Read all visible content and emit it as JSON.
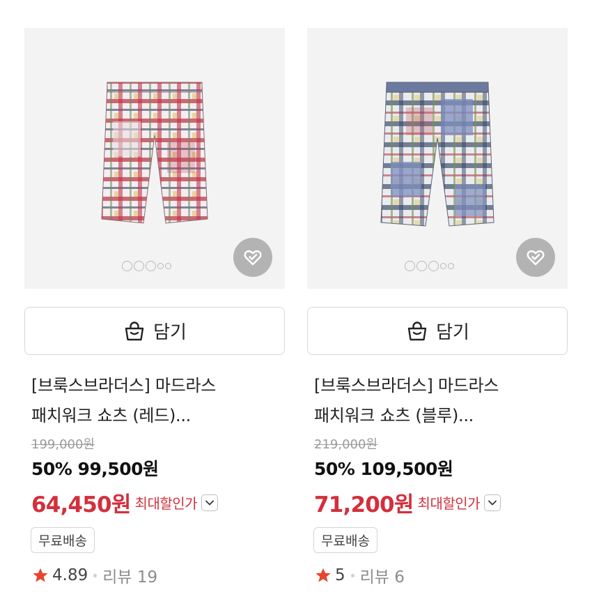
{
  "colors": {
    "accent_red": "#d32f3c",
    "card_bg": "#f3f3f3",
    "wish_bg": "#b3b3b3",
    "star": "#e8442e"
  },
  "products": [
    {
      "title_line1": "[브룩스브라더스] 마드라스",
      "title_line2": "패치워크 쇼츠 (레드)...",
      "original_price": "199,000원",
      "discount_price": "50% 99,500원",
      "max_discount_price": "64,450원",
      "max_discount_label": "최대할인가",
      "cart_label": "담기",
      "shipping_badge": "무료배송",
      "rating": "4.89",
      "reviews": "리뷰 19",
      "image_icon": "plaid-shorts-red",
      "image_index": 1,
      "image_count": 5
    },
    {
      "title_line1": "[브룩스브라더스] 마드라스",
      "title_line2": "패치워크 쇼츠 (블루)...",
      "original_price": "219,000원",
      "discount_price": "50% 109,500원",
      "max_discount_price": "71,200원",
      "max_discount_label": "최대할인가",
      "cart_label": "담기",
      "shipping_badge": "무료배송",
      "rating": "5",
      "reviews": "리뷰 6",
      "image_icon": "plaid-shorts-blue",
      "image_index": 1,
      "image_count": 5
    }
  ]
}
